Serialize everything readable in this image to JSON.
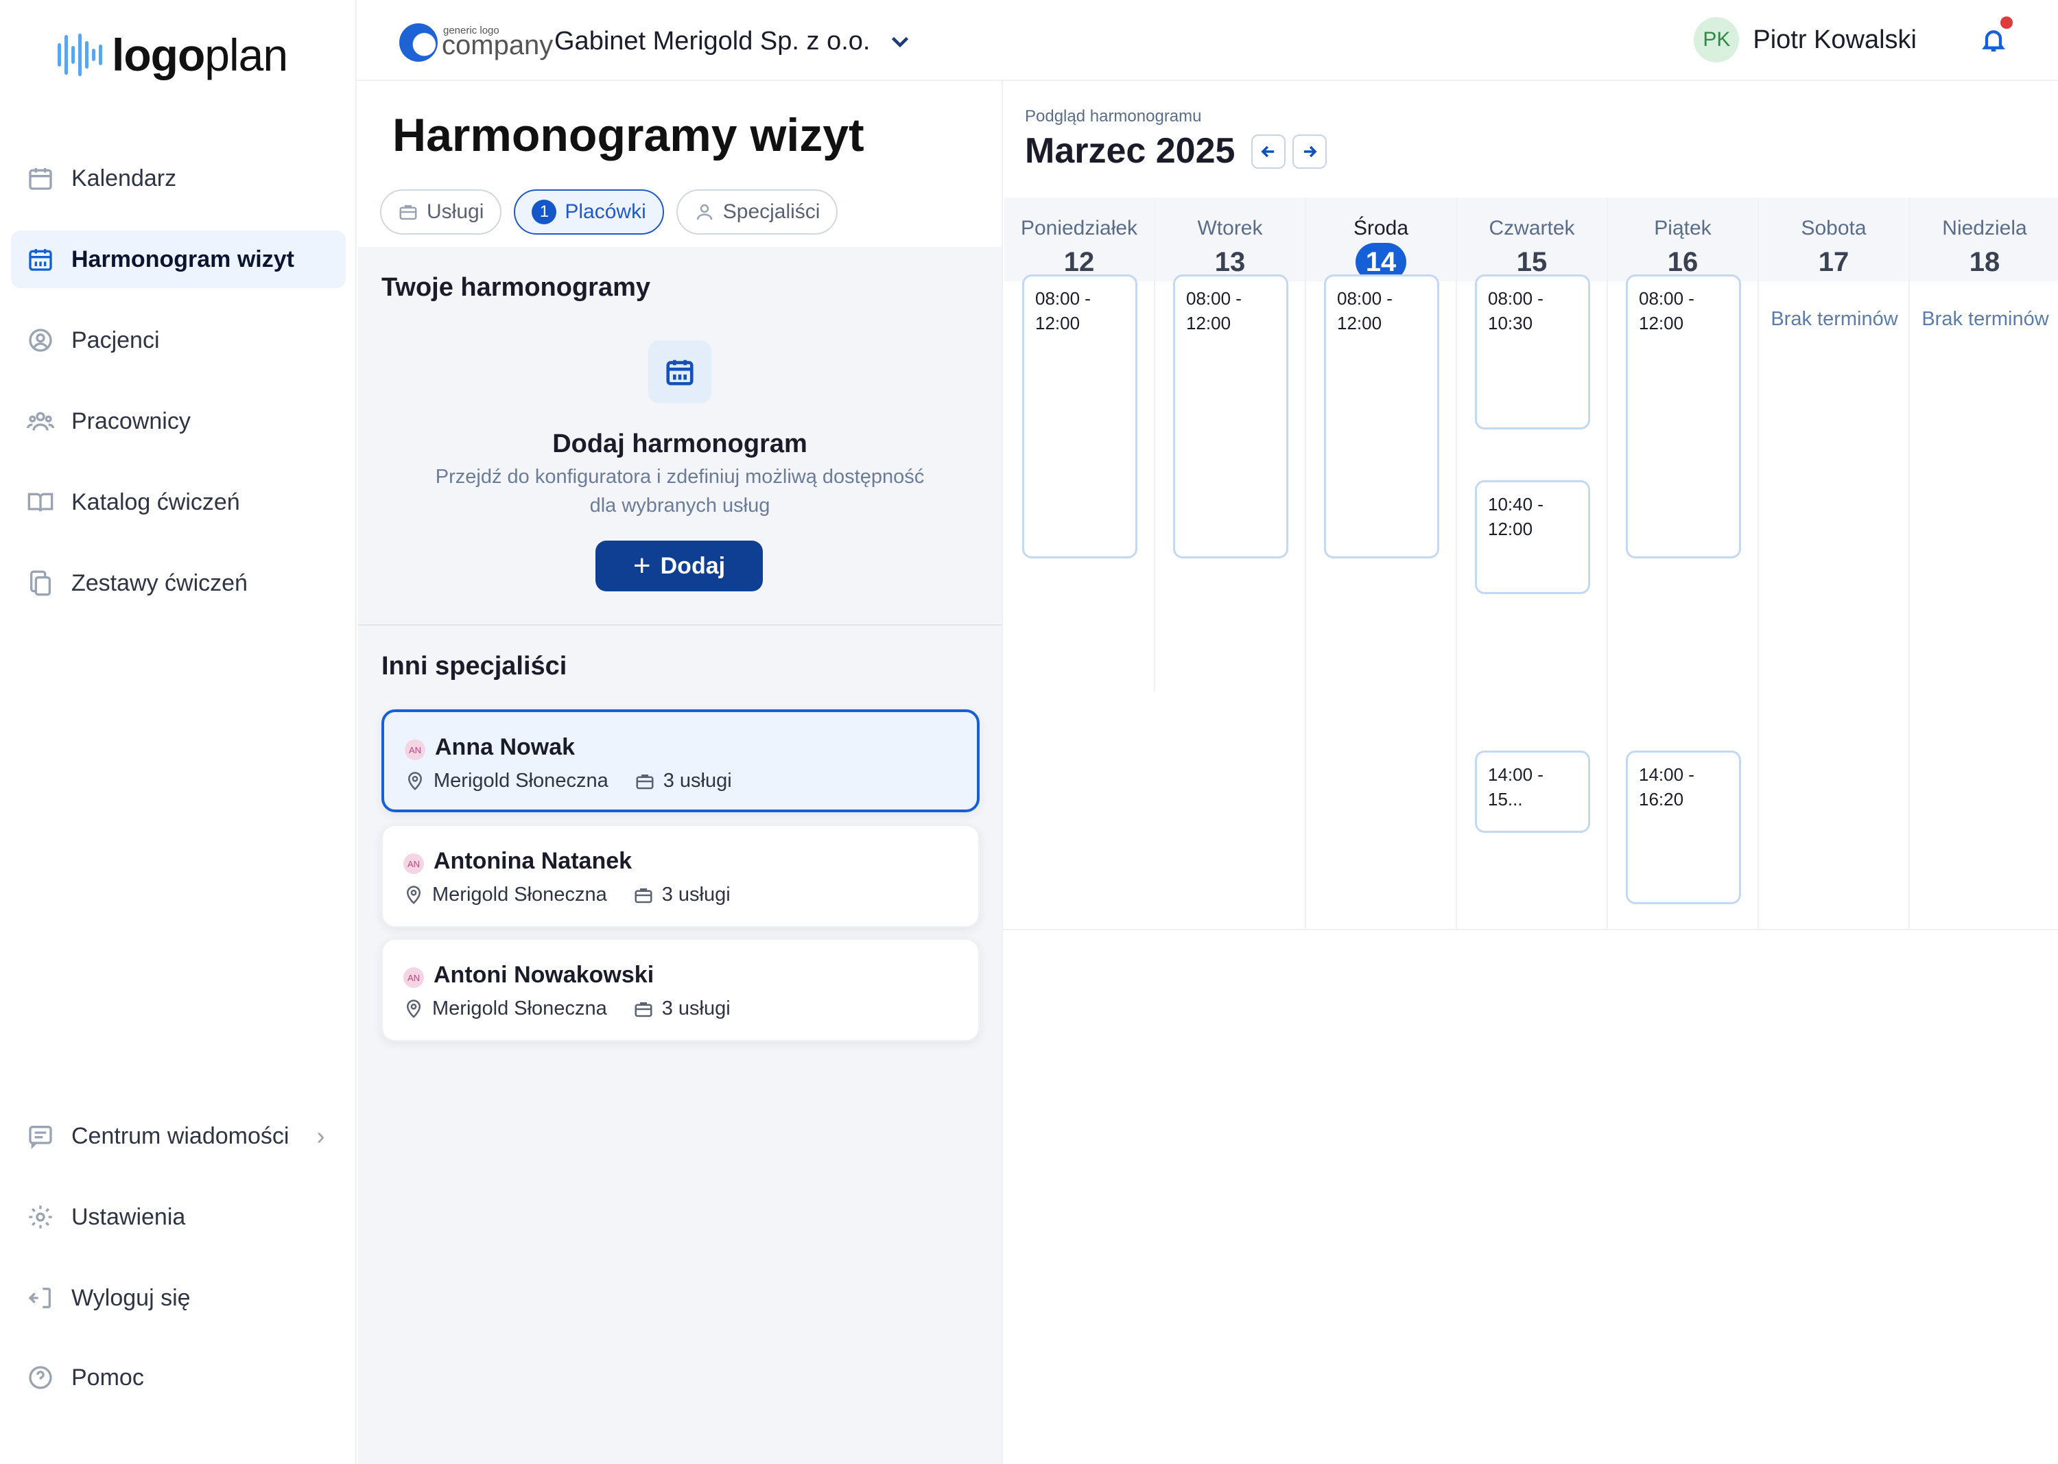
{
  "brand": {
    "logo_bold": "logo",
    "logo_light": "plan"
  },
  "sidebar": {
    "items": [
      {
        "label": "Kalendarz",
        "icon": "calendar-icon"
      },
      {
        "label": "Harmonogram wizyt",
        "icon": "schedule-calendar-icon",
        "active": true
      },
      {
        "label": "Pacjenci",
        "icon": "user-circle-icon"
      },
      {
        "label": "Pracownicy",
        "icon": "users-icon"
      },
      {
        "label": "Katalog ćwiczeń",
        "icon": "book-open-icon"
      },
      {
        "label": "Zestawy ćwiczeń",
        "icon": "copy-icon"
      }
    ],
    "bottom_items": [
      {
        "label": "Centrum wiadomości",
        "icon": "message-icon",
        "has_chevron": true
      },
      {
        "label": "Ustawienia",
        "icon": "gear-icon"
      },
      {
        "label": "Wyloguj się",
        "icon": "logout-icon"
      },
      {
        "label": "Pomoc",
        "icon": "help-circle-icon"
      }
    ]
  },
  "topbar": {
    "company_logo_small": "generic logo",
    "company_logo_big": "company",
    "company_name": "Gabinet Merigold Sp. z o.o.",
    "user_initials": "PK",
    "user_name": "Piotr Kowalski",
    "has_notification": true
  },
  "middle": {
    "title": "Harmonogramy wizyt",
    "chips": [
      {
        "label": "Usługi",
        "icon": "briefcase-icon"
      },
      {
        "label": "Placówki",
        "count": "1",
        "active": true
      },
      {
        "label": "Specjaliści",
        "icon": "person-icon"
      }
    ],
    "your_schedules": {
      "title": "Twoje harmonogramy",
      "empty_title": "Dodaj harmonogram",
      "empty_desc_line1": "Przejdź do konfiguratora i zdefiniuj możliwą dostępność",
      "empty_desc_line2": "dla wybranych usług",
      "add_label": "Dodaj"
    },
    "others": {
      "title": "Inni specjaliści",
      "specialists": [
        {
          "initials": "AN",
          "name": "Anna Nowak",
          "location": "Merigold Słoneczna",
          "services": "3 usługi",
          "selected": true
        },
        {
          "initials": "AN",
          "name": "Antonina Natanek",
          "location": "Merigold Słoneczna",
          "services": "3 usługi"
        },
        {
          "initials": "AN",
          "name": "Antoni Nowakowski",
          "location": "Merigold Słoneczna",
          "services": "3 usługi"
        }
      ]
    }
  },
  "calendar": {
    "preview_label": "Podgląd harmonogramu",
    "month": "Marzec 2025",
    "days": [
      {
        "name": "Poniedziałek",
        "num": "12",
        "slots": [
          {
            "label": "08:00 - 12:00"
          }
        ]
      },
      {
        "name": "Wtorek",
        "num": "13",
        "slots": [
          {
            "label": "08:00 - 12:00"
          }
        ]
      },
      {
        "name": "Środa",
        "num": "14",
        "today": true,
        "slots": [
          {
            "label": "08:00 - 12:00"
          }
        ]
      },
      {
        "name": "Czwartek",
        "num": "15",
        "slots": [
          {
            "label": "08:00 - 10:30"
          },
          {
            "label": "10:40 - 12:00"
          },
          {
            "label": "14:00 - 15..."
          }
        ]
      },
      {
        "name": "Piątek",
        "num": "16",
        "slots": [
          {
            "label": "08:00 - 12:00"
          },
          {
            "label": "14:00 - 16:20"
          }
        ]
      },
      {
        "name": "Sobota",
        "num": "17",
        "empty_label": "Brak terminów"
      },
      {
        "name": "Niedziela",
        "num": "18",
        "empty_label": "Brak terminów"
      }
    ]
  }
}
